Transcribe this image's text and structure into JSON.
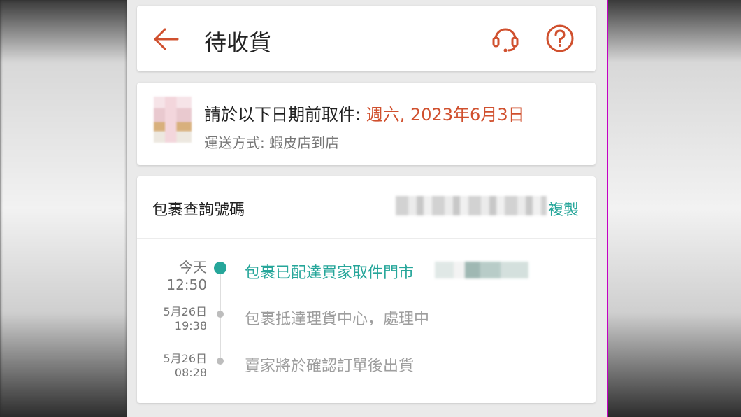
{
  "header": {
    "title": "待收貨"
  },
  "pickup": {
    "deadline_label": "請於以下日期前取件: ",
    "deadline_date": "週六, 2023年6月3日",
    "shipping": "運送方式: 蝦皮店到店"
  },
  "tracking": {
    "label": "包裹查詢號碼",
    "copy_label": "複製",
    "events": [
      {
        "time_line1": "今天",
        "time_line2": "12:50",
        "text": "包裹已配達買家取件門市"
      },
      {
        "time_line1": "5月26日",
        "time_line2": "19:38",
        "text": "包裹抵達理貨中心，處理中"
      },
      {
        "time_line1": "5月26日",
        "time_line2": "08:28",
        "text": "賣家將於確認訂單後出貨"
      }
    ]
  },
  "colors": {
    "accent": "#d0502e",
    "teal": "#26a69a",
    "muted": "#9e9e9e"
  },
  "icons": {
    "back": "arrow-left",
    "support": "headset",
    "help": "question-circle"
  }
}
